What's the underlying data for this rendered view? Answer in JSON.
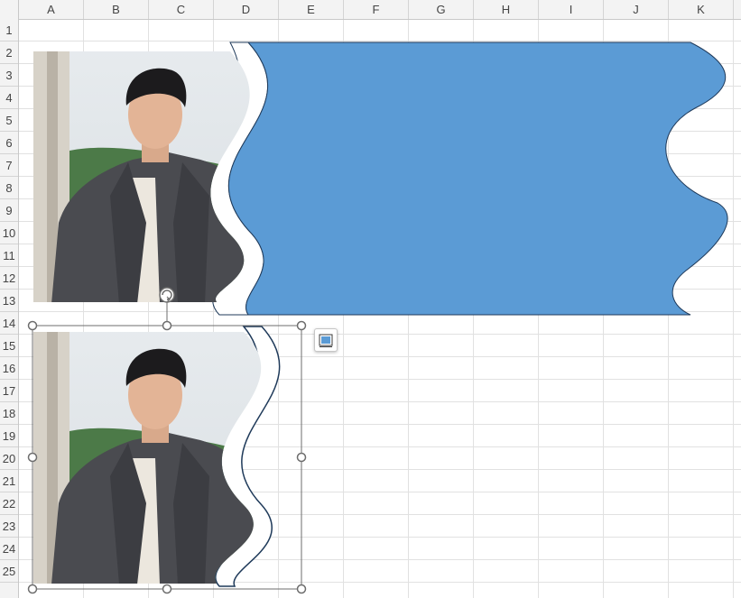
{
  "sheet": {
    "columns": [
      "A",
      "B",
      "C",
      "D",
      "E",
      "F",
      "G",
      "H",
      "I",
      "J",
      "K"
    ],
    "rows": [
      "1",
      "2",
      "3",
      "4",
      "5",
      "6",
      "7",
      "8",
      "9",
      "10",
      "11",
      "12",
      "13",
      "14",
      "15",
      "16",
      "17",
      "18",
      "19",
      "20",
      "21",
      "22",
      "23",
      "24",
      "25"
    ]
  },
  "colors": {
    "wave_fill": "#5b9bd5",
    "wave_stroke": "#1f3a5a",
    "selection_handle": "#6d6d6d",
    "gridline": "#e1e1e1"
  },
  "shapes": {
    "top": {
      "name": "wave-shape-blue-with-photo"
    },
    "bottom": {
      "name": "wave-shape-photo-selected",
      "selected": true
    }
  },
  "icons": {
    "rotate": "rotate-handle-icon",
    "layout_options": "layout-options-icon"
  }
}
